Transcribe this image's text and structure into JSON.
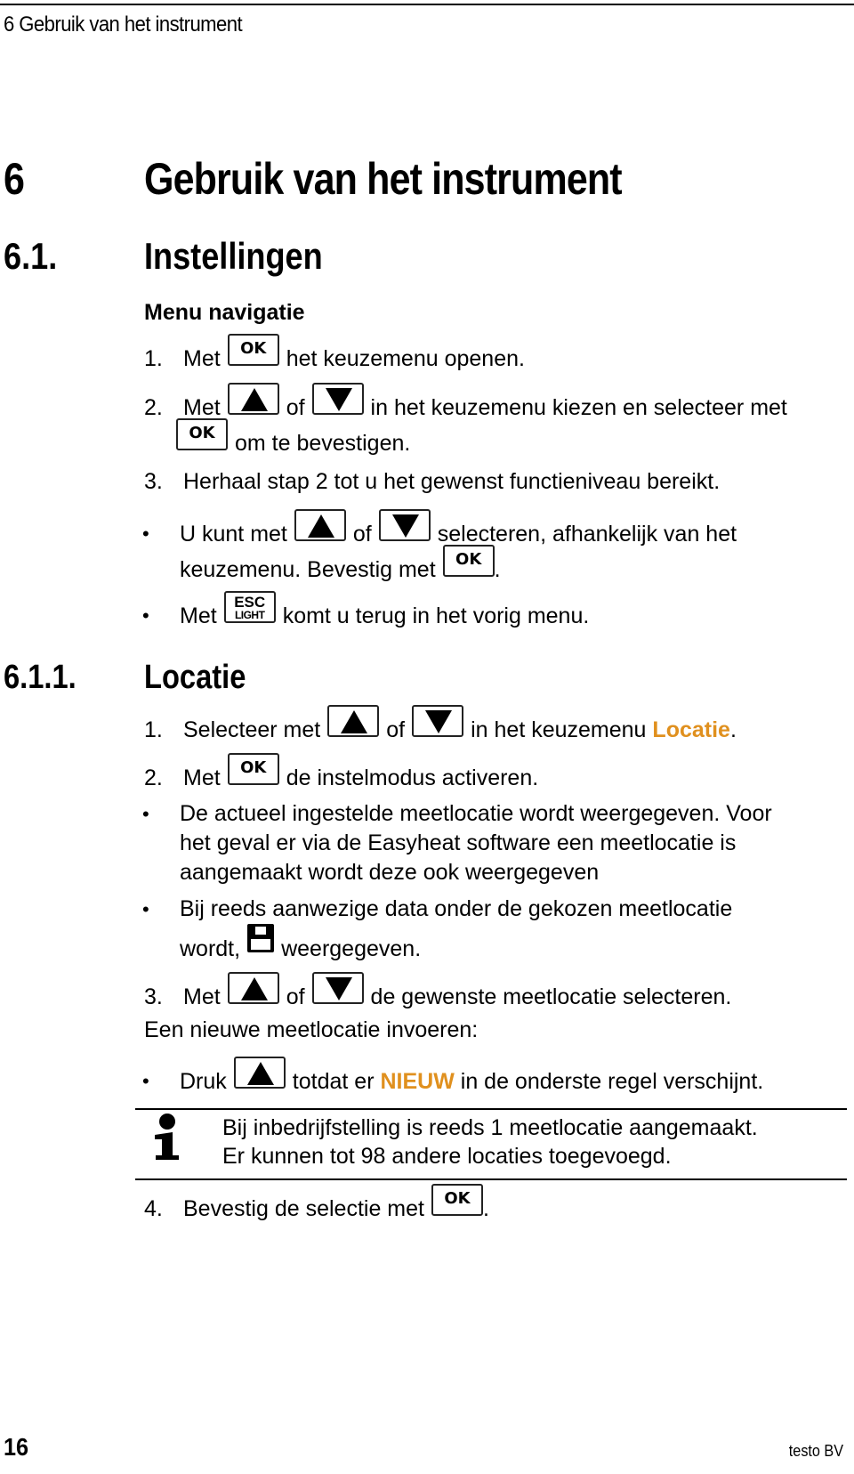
{
  "running_header": "6 Gebruik van het instrument",
  "chapter": {
    "number": "6",
    "title": "Gebruik van het instrument"
  },
  "section": {
    "number": "6.1.",
    "title": "Instellingen"
  },
  "menu_nav": {
    "heading": "Menu navigatie",
    "step1": {
      "n": "1.",
      "pre": "Met",
      "post": "het keuzemenu openen."
    },
    "step2": {
      "n": "2.",
      "pre": "Met",
      "of": "of",
      "post": "in het keuzemenu kiezen en selecteer met",
      "cont": "om te bevestigen."
    },
    "step3": {
      "n": "3.",
      "text": "Herhaal stap 2 tot u het gewenst functieniveau bereikt."
    },
    "bullet1": {
      "pre": "U kunt met",
      "of": "of",
      "post": "selecteren, afhankelijk van het",
      "cont_pre": "keuzemenu. Bevestig met",
      "cont_post": "."
    },
    "bullet2": {
      "pre": "Met",
      "post": "komt u terug in het vorig menu."
    }
  },
  "keys": {
    "ok": "OK",
    "esc_top": "ESC",
    "esc_bottom": "LIGHT"
  },
  "subsection": {
    "number": "6.1.1.",
    "title": "Locatie"
  },
  "locatie": {
    "step1": {
      "n": "1.",
      "pre": "Selecteer met",
      "of": "of",
      "post": "in het keuzemenu",
      "highlight": "Locatie",
      "end": "."
    },
    "step2": {
      "n": "2.",
      "pre": "Met",
      "post": "de instelmodus activeren."
    },
    "bullet1": [
      "De actueel ingestelde meetlocatie wordt weergegeven. Voor",
      "het geval er via de Easyheat software een meetlocatie is",
      "aangemaakt wordt deze ook weergegeven"
    ],
    "bullet2": {
      "line1": "Bij reeds aanwezige data onder de gekozen meetlocatie",
      "pre": "wordt,",
      "post": "weergegeven."
    },
    "step3": {
      "n": "3.",
      "pre": "Met",
      "of": "of",
      "post": "de gewenste meetlocatie selecteren."
    },
    "new_heading": "Een nieuwe meetlocatie invoeren:",
    "bullet3": {
      "pre": "Druk",
      "mid": "totdat er",
      "highlight": "NIEUW",
      "post": "in de onderste regel verschijnt."
    },
    "note": [
      "Bij inbedrijfstelling is reeds 1 meetlocatie aangemaakt.",
      "Er kunnen tot 98 andere locaties toegevoegd."
    ],
    "step4": {
      "n": "4.",
      "pre": "Bevestig de selectie met",
      "end": "."
    }
  },
  "footer": {
    "page": "16",
    "brand": "testo BV"
  },
  "colors": {
    "highlight": "#E0901E"
  }
}
